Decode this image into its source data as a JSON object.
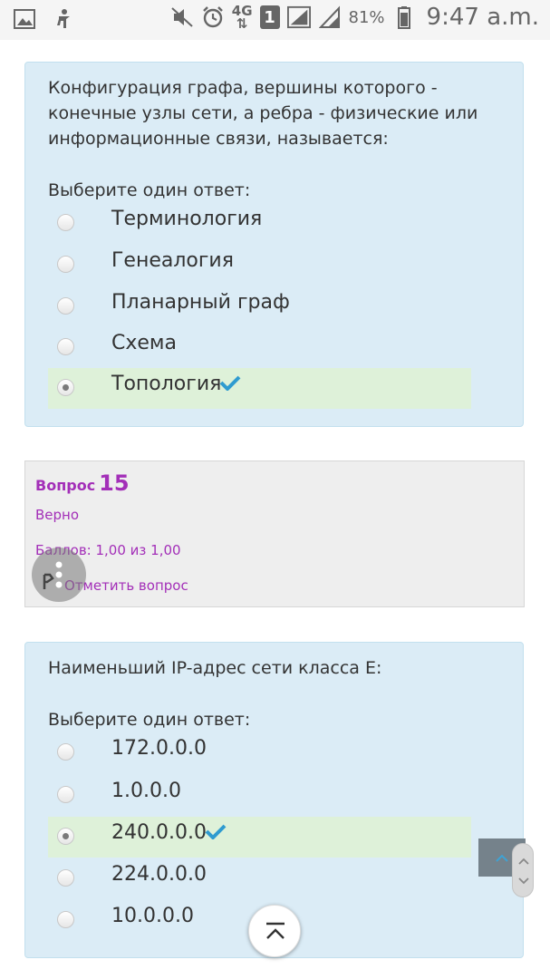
{
  "statusbar": {
    "left_icons": [
      "image-icon",
      "accessibility-icon"
    ],
    "network": "4G",
    "sim_badge": "1",
    "battery": "81%",
    "time": "9:47 a.m."
  },
  "q14": {
    "text": "Конфигурация графа, вершины которого - конечные узлы сети, а ребра - физические или информационные связи, называется:",
    "prompt": "Выберите один ответ:",
    "options": [
      "Терминология",
      "Генеалогия",
      "Планарный граф",
      "Схема",
      "Топология"
    ],
    "selected_index": 4
  },
  "q15info": {
    "label": "Вопрос",
    "number": "15",
    "state": "Верно",
    "grade": "Баллов: 1,00 из 1,00",
    "flag": "Отметить вопрос"
  },
  "q15": {
    "text": "Наименьший IP-адрес сети класса E:",
    "prompt": "Выберите один ответ:",
    "options": [
      "172.0.0.0",
      "1.0.0.0",
      "240.0.0.0",
      "224.0.0.0",
      "10.0.0.0"
    ],
    "selected_index": 2
  },
  "colors": {
    "card_bg": "#dbecf6",
    "correct_bg": "#def1d9",
    "accent_purple": "#a32fb8",
    "check_blue": "#2f9bd0"
  }
}
